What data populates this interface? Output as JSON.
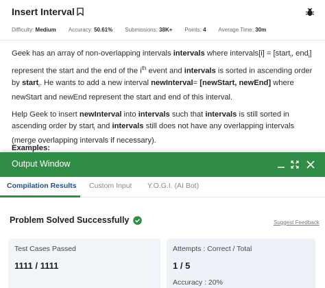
{
  "problem": {
    "title": "Insert Interval",
    "meta": [
      {
        "label": "Difficulty: ",
        "value": "Medium"
      },
      {
        "label": "Accuracy: ",
        "value": "50.61%"
      },
      {
        "label": "Submissions: ",
        "value": "38K+"
      },
      {
        "label": "Points: ",
        "value": "4"
      },
      {
        "label": "Average Time: ",
        "value": "30m"
      }
    ],
    "description": {
      "p1": {
        "t1": "Geek has an array of non-overlapping intervals ",
        "b1": "intervals",
        "t2": " where intervals[i] = [start",
        "sub1": "i",
        "t3": ", end",
        "sub2": "i",
        "t4": "] represent the start and the end of the i",
        "sup1": "th",
        "t5": " event and ",
        "b2": "intervals",
        "t6": " is sorted in ascending order by ",
        "b3": "start",
        "sub3": "i",
        "t7": ". He wants to add a new interval ",
        "b4": "newInterval",
        "t8": "= ",
        "b5": "[newStart, newEnd]",
        "t9": " where newStart and newEnd represent the start and end of this interval."
      },
      "p2": {
        "t1": "Help Geek to insert ",
        "b1": "newInterval",
        "t2": " into ",
        "b2": "intervals",
        "t3": " such that ",
        "b3": "intervals",
        "t4": " is still sorted in ascending order by start",
        "sub1": "i",
        "t5": " and ",
        "b4": "intervals",
        "t6": " still does not have any overlapping intervals (merge overlapping intervals if necessary)."
      }
    },
    "examples_heading": "Examples:"
  },
  "output_window": {
    "title": "Output Window",
    "tabs": [
      "Compilation Results",
      "Custom Input",
      "Y.O.G.I. (AI Bot)"
    ],
    "active_tab": 0,
    "status": "Problem Solved Successfully",
    "suggest_feedback": "Suggest Feedback",
    "cards": {
      "test_cases": {
        "label": "Test Cases Passed",
        "value": "1111 / 1111"
      },
      "attempts": {
        "label": "Attempts : Correct / Total",
        "value": "1 / 5",
        "accuracy": "Accuracy : 20%"
      }
    }
  },
  "colors": {
    "accent_green": "#2f8d46",
    "active_tab_text": "#1f4f8f",
    "card_bg": "#f1f4f8"
  },
  "icons": [
    "bookmark-icon",
    "bug-icon",
    "minimize-icon",
    "maximize-icon",
    "close-icon",
    "check-circle-icon"
  ]
}
